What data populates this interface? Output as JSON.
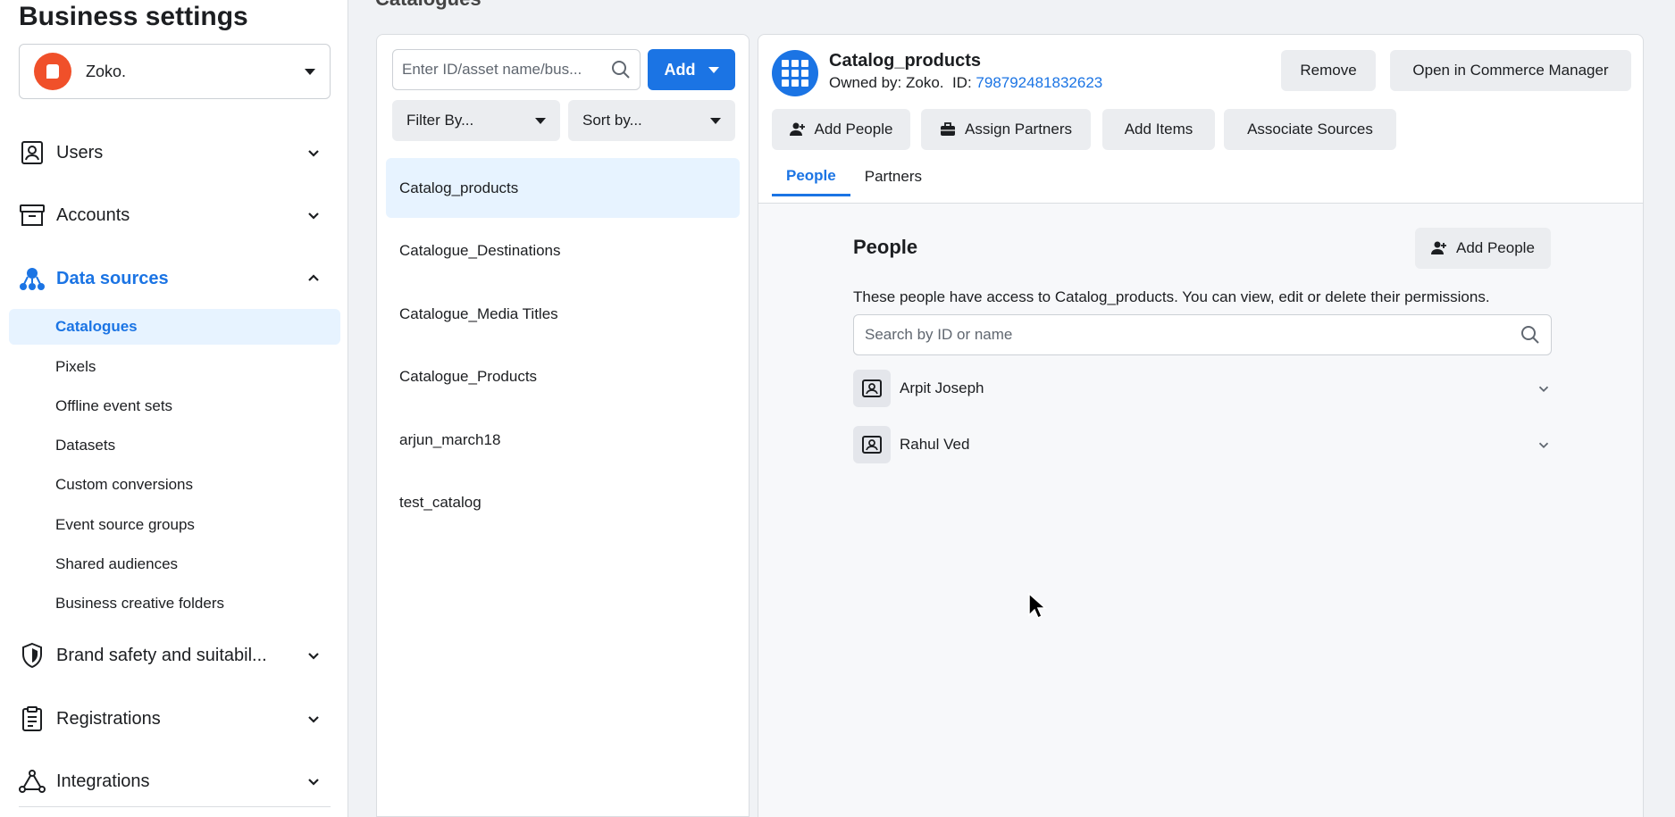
{
  "sidebar": {
    "title": "Business settings",
    "business": {
      "name": "Zoko."
    },
    "nav": {
      "users": "Users",
      "accounts": "Accounts",
      "data_sources": "Data sources",
      "brand_safety": "Brand safety and suitabil...",
      "registrations": "Registrations",
      "integrations": "Integrations"
    },
    "sub_items": [
      "Catalogues",
      "Pixels",
      "Offline event sets",
      "Datasets",
      "Custom conversions",
      "Event source groups",
      "Shared audiences",
      "Business creative folders"
    ]
  },
  "header": {
    "cropped_title": "Catalogues"
  },
  "list": {
    "search_placeholder": "Enter ID/asset name/bus...",
    "add_label": "Add",
    "filter_label": "Filter By...",
    "sort_label": "Sort by...",
    "items": [
      "Catalog_products",
      "Catalogue_Destinations",
      "Catalogue_Media Titles",
      "Catalogue_Products",
      "arjun_march18",
      "test_catalog"
    ]
  },
  "detail": {
    "name": "Catalog_products",
    "owner_prefix": "Owned by: Zoko.  ID: ",
    "id": "798792481832623",
    "buttons": {
      "remove": "Remove",
      "open_commerce": "Open in Commerce Manager",
      "add_people": "Add People",
      "assign_partners": "Assign Partners",
      "add_items": "Add Items",
      "associate_sources": "Associate Sources"
    },
    "tabs": [
      "People",
      "Partners"
    ],
    "people": {
      "title": "People",
      "add_label": "Add People",
      "description": "These people have access to Catalog_products. You can view, edit or delete their permissions.",
      "search_placeholder": "Search by ID or name",
      "list": [
        "Arpit Joseph",
        "Rahul Ved"
      ]
    }
  },
  "colors": {
    "accent": "#1b74e4",
    "brand_logo": "#f0502a"
  }
}
